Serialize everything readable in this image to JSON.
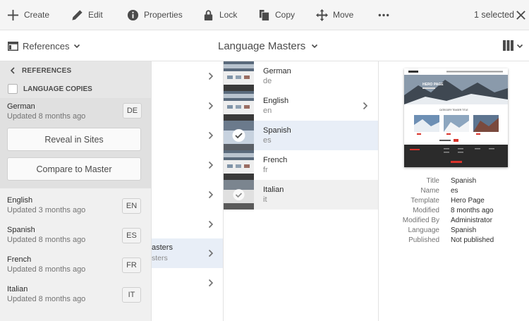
{
  "actionbar": {
    "create": "Create",
    "edit": "Edit",
    "properties": "Properties",
    "lock": "Lock",
    "copy": "Copy",
    "move": "Move",
    "selected": "1 selected"
  },
  "header": {
    "rail_toggle": "References",
    "title": "Language Masters"
  },
  "rail": {
    "back_label": "REFERENCES",
    "language_copies_label": "LANGUAGE COPIES",
    "active": {
      "name": "German",
      "updated": "Updated 8 months ago",
      "code": "DE"
    },
    "reveal_button": "Reveal in Sites",
    "compare_button": "Compare to Master",
    "languages": [
      {
        "name": "English",
        "updated": "Updated 3 months ago",
        "code": "EN"
      },
      {
        "name": "Spanish",
        "updated": "Updated 8 months ago",
        "code": "ES"
      },
      {
        "name": "French",
        "updated": "Updated 8 months ago",
        "code": "FR"
      },
      {
        "name": "Italian",
        "updated": "Updated 8 months ago",
        "code": "IT"
      }
    ]
  },
  "column1": {
    "selected_title": "asters",
    "selected_sub": "sters"
  },
  "column2": {
    "items": [
      {
        "name": "German",
        "sub": "de"
      },
      {
        "name": "English",
        "sub": "en"
      },
      {
        "name": "Spanish",
        "sub": "es"
      },
      {
        "name": "French",
        "sub": "fr"
      },
      {
        "name": "Italian",
        "sub": "it"
      }
    ]
  },
  "preview": {
    "thumb_hero": "HERO PAGE",
    "thumb_section": "CATEGORY TEASER TITLE",
    "meta": [
      {
        "key": "Title",
        "value": "Spanish"
      },
      {
        "key": "Name",
        "value": "es"
      },
      {
        "key": "Template",
        "value": "Hero Page"
      },
      {
        "key": "Modified",
        "value": "8 months ago"
      },
      {
        "key": "Modified By",
        "value": "Administrator"
      },
      {
        "key": "Language",
        "value": "Spanish"
      },
      {
        "key": "Published",
        "value": "Not published"
      }
    ]
  },
  "colors": {
    "selection": "#e8eef7",
    "rail_bg": "#f0f0f0",
    "text": "#4b4b4b"
  }
}
